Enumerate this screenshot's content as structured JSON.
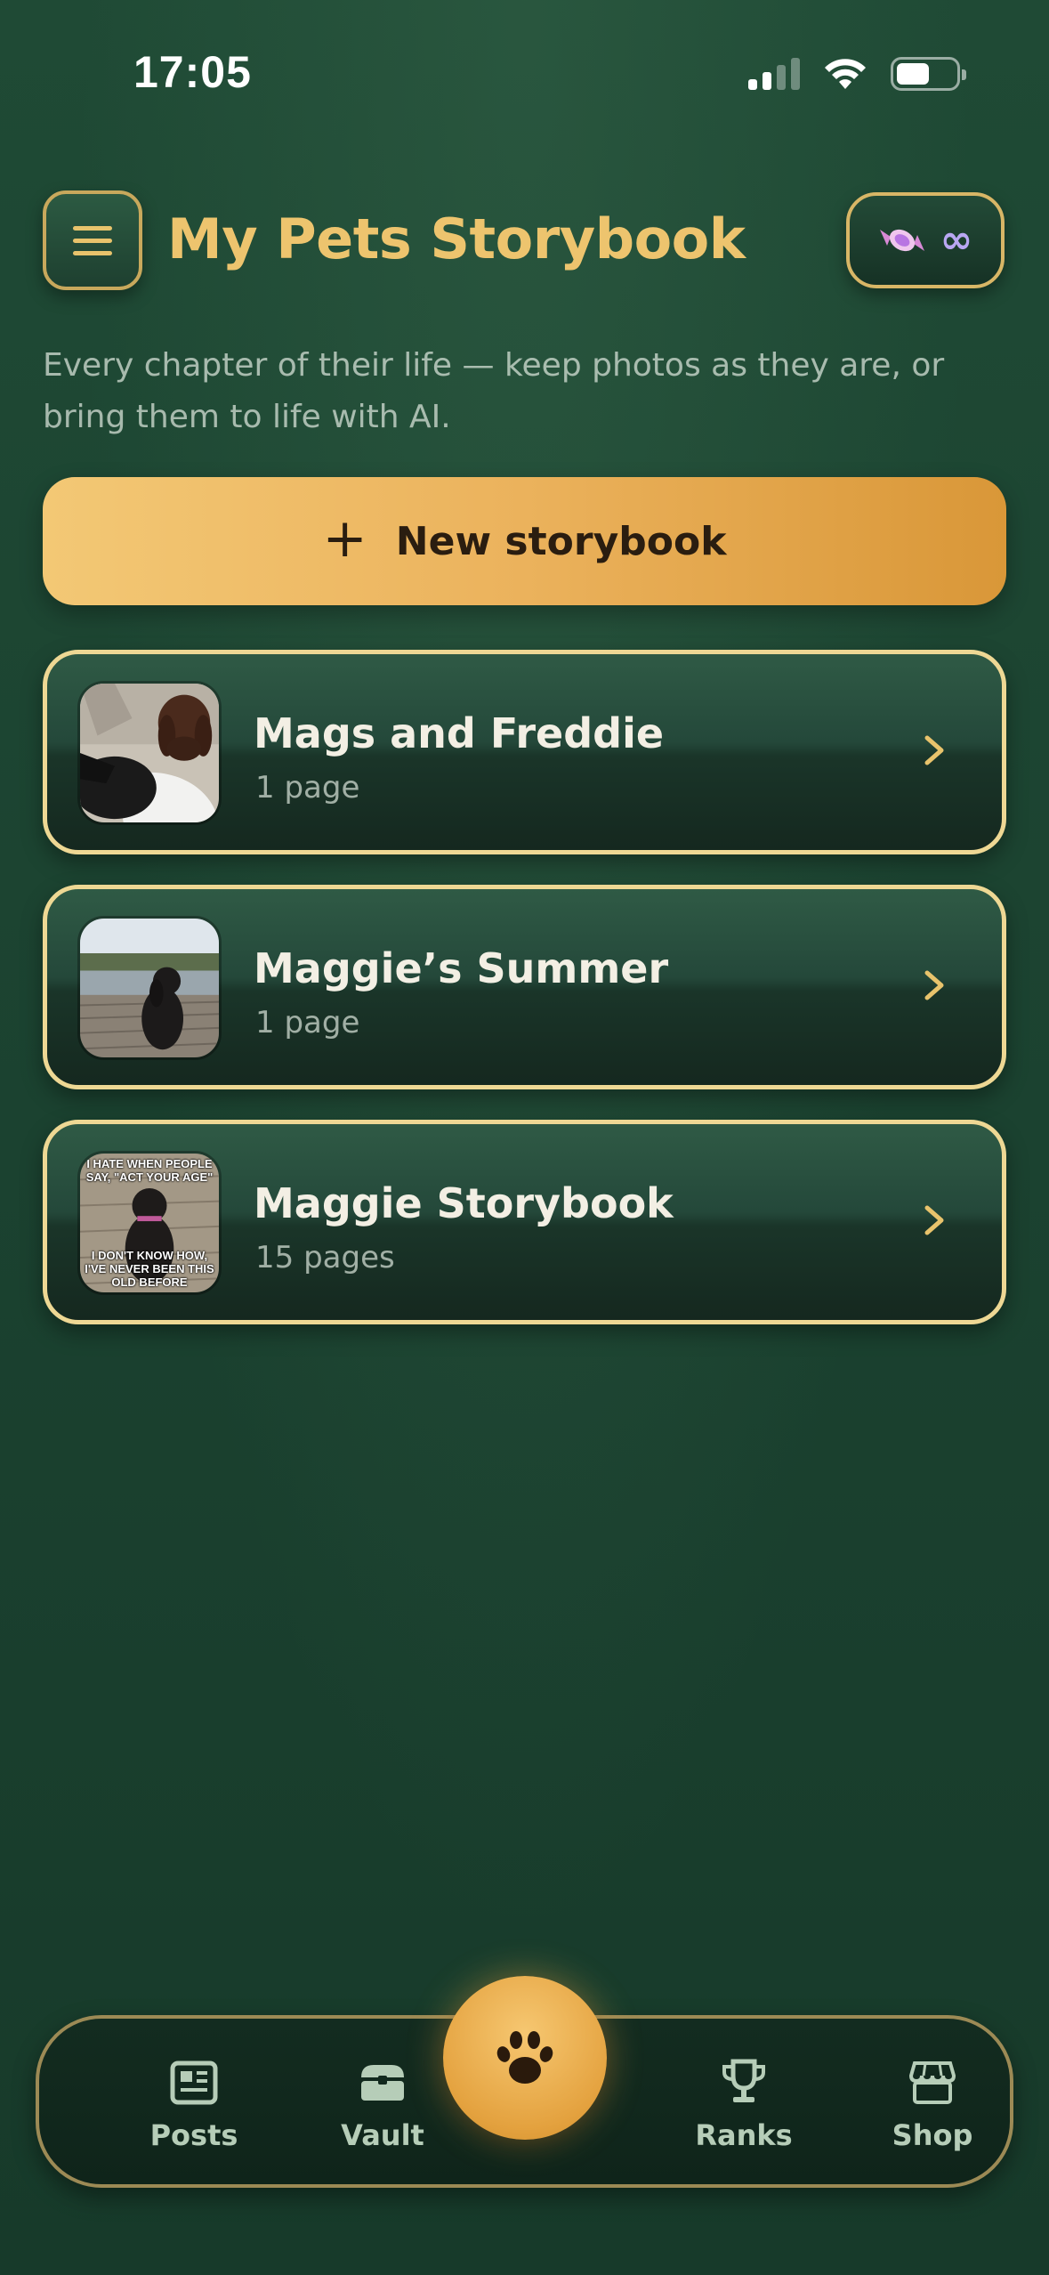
{
  "status_bar": {
    "time": "17:05"
  },
  "header": {
    "title": "My Pets Storybook",
    "menu_icon": "hamburger-icon",
    "currency_icon": "candy-icon",
    "currency_value": "∞"
  },
  "subtitle": "Every chapter of their life — keep photos as they are, or bring them to life with AI.",
  "new_button": {
    "plus": "+",
    "label": "New storybook"
  },
  "storybooks": [
    {
      "title": "Mags and Freddie",
      "count": "1 page"
    },
    {
      "title": "Maggie’s Summer",
      "count": "1 page"
    },
    {
      "title": "Maggie Storybook",
      "count": "15 pages",
      "meme_top": "I HATE WHEN PEOPLE SAY, \"ACT YOUR AGE\"",
      "meme_bottom": "I DON'T KNOW HOW, I'VE NEVER BEEN THIS OLD BEFORE"
    }
  ],
  "nav": {
    "items": [
      {
        "label": "Posts",
        "icon": "newspaper-icon"
      },
      {
        "label": "Vault",
        "icon": "chest-icon"
      },
      {
        "label": "",
        "icon": "paw-icon"
      },
      {
        "label": "Ranks",
        "icon": "trophy-icon"
      },
      {
        "label": "Shop",
        "icon": "store-icon"
      }
    ]
  },
  "colors": {
    "background": "#1c4431",
    "gold": "#edc46e",
    "card_border": "#eed894",
    "button_orange": "#e8a94c"
  }
}
